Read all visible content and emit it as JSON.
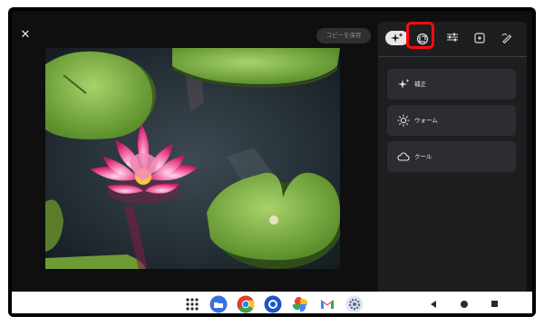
{
  "editor": {
    "save_copy_label": "コピーを保存"
  },
  "tabs": [
    {
      "name": "suggestions",
      "icon": "sparkle-icon",
      "active": true
    },
    {
      "name": "crop-rotate",
      "icon": "crop-rotate-icon",
      "highlighted": true
    },
    {
      "name": "adjust",
      "icon": "sliders-icon"
    },
    {
      "name": "filters",
      "icon": "filter-icon"
    },
    {
      "name": "markup",
      "icon": "markup-icon"
    }
  ],
  "suggestions": [
    {
      "label": "補正",
      "icon": "sparkle-icon"
    },
    {
      "label": "ウォーム",
      "icon": "sun-icon"
    },
    {
      "label": "クール",
      "icon": "cloud-icon"
    }
  ],
  "taskbar": {
    "apps": [
      "app-drawer-icon",
      "files-icon",
      "chrome-icon",
      "camera-icon",
      "photos-icon",
      "gmail-icon",
      "settings-icon"
    ],
    "nav": [
      "back-icon",
      "home-icon",
      "recents-icon"
    ]
  },
  "colors": {
    "highlight": "#ff0a12",
    "panel": "#1d1e20",
    "card": "#2c2d30"
  }
}
